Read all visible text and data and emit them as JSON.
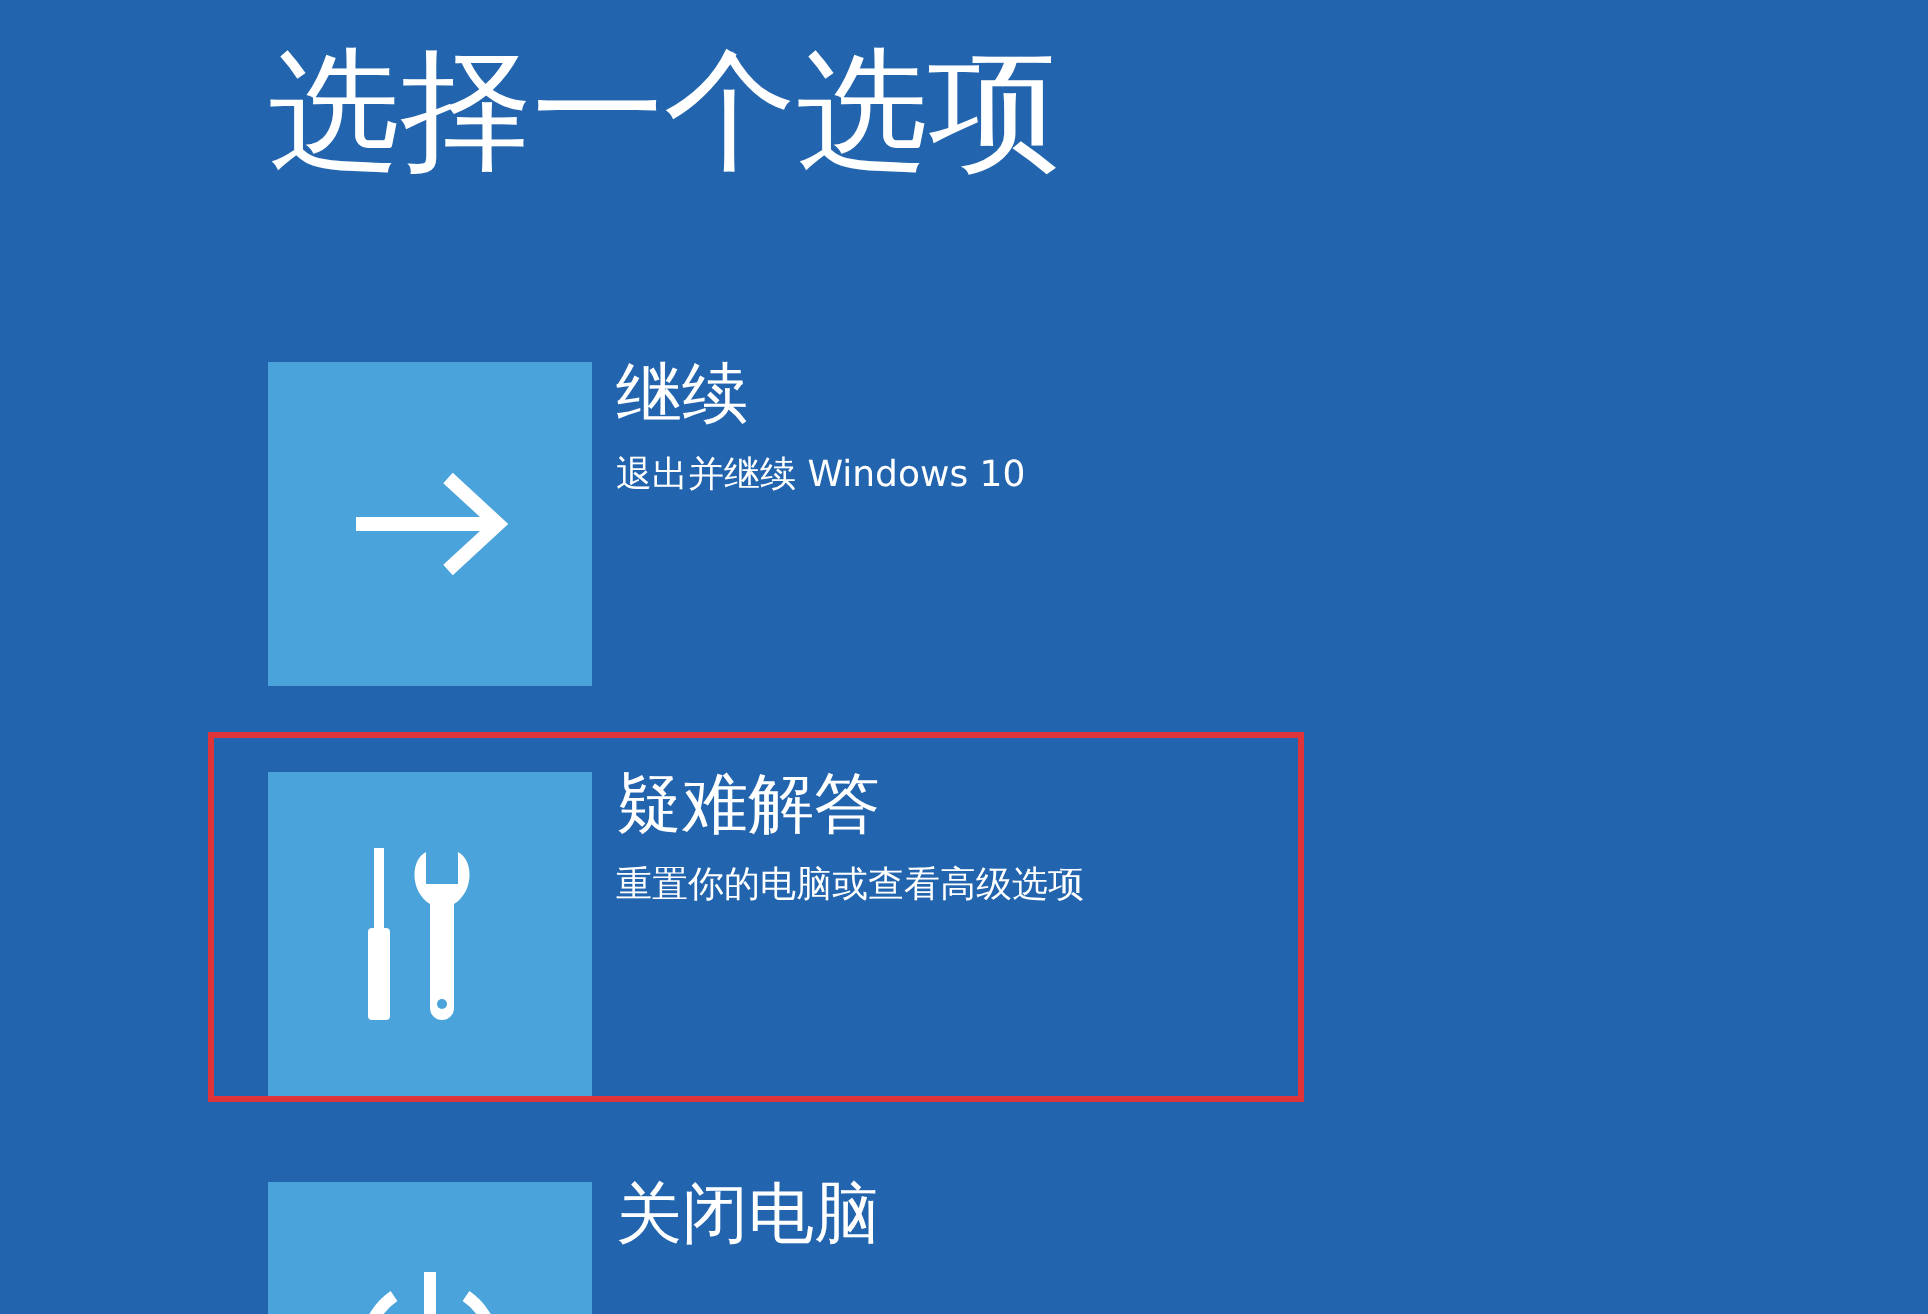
{
  "title": "选择一个选项",
  "options": [
    {
      "kind": "arrow",
      "label": "继续",
      "description": "退出并继续 Windows 10",
      "highlighted": false
    },
    {
      "kind": "tools",
      "label": "疑难解答",
      "description": "重置你的电脑或查看高级选项",
      "highlighted": true
    },
    {
      "kind": "power",
      "label": "关闭电脑",
      "highlighted": false
    }
  ]
}
